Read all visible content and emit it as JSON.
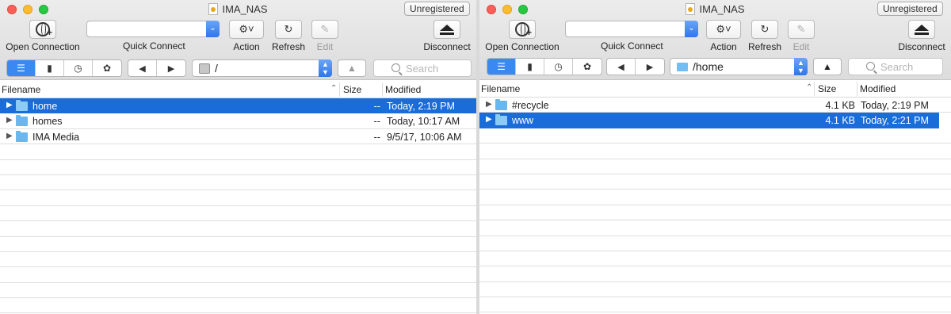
{
  "windows": [
    {
      "title": "IMA_NAS",
      "badge": "Unregistered",
      "toolbar": {
        "open_connection": "Open Connection",
        "quick_connect": "Quick Connect",
        "action": "Action",
        "refresh": "Refresh",
        "edit": "Edit",
        "disconnect": "Disconnect"
      },
      "path": "/",
      "search_placeholder": "Search",
      "columns": {
        "filename": "Filename",
        "size": "Size",
        "modified": "Modified"
      },
      "rows": [
        {
          "name": "home",
          "size": "--",
          "modified": "Today, 2:19 PM",
          "selected": true
        },
        {
          "name": "homes",
          "size": "--",
          "modified": "Today, 10:17 AM",
          "selected": false
        },
        {
          "name": "IMA Media",
          "size": "--",
          "modified": "9/5/17, 10:06 AM",
          "selected": false
        }
      ]
    },
    {
      "title": "IMA_NAS",
      "badge": "Unregistered",
      "toolbar": {
        "open_connection": "Open Connection",
        "quick_connect": "Quick Connect",
        "action": "Action",
        "refresh": "Refresh",
        "edit": "Edit",
        "disconnect": "Disconnect"
      },
      "path": "/home",
      "search_placeholder": "Search",
      "columns": {
        "filename": "Filename",
        "size": "Size",
        "modified": "Modified"
      },
      "rows": [
        {
          "name": "#recycle",
          "size": "4.1 KB",
          "modified": "Today, 2:19 PM",
          "selected": false
        },
        {
          "name": "www",
          "size": "4.1 KB",
          "modified": "Today, 2:21 PM",
          "selected": true
        }
      ]
    }
  ],
  "icons": {
    "open_connection": "globe-plus-icon",
    "action": "gear-icon",
    "refresh": "refresh-icon",
    "edit": "pencil-icon",
    "disconnect": "eject-icon",
    "browser": "list-view-icon",
    "bookmarks": "bookmark-icon",
    "history": "history-icon",
    "bonjour": "bonjour-icon",
    "back": "back-arrow-icon",
    "forward": "forward-arrow-icon",
    "up": "up-arrow-icon",
    "search": "search-icon",
    "folder": "folder-icon"
  },
  "colors": {
    "selection": "#1a6cd9",
    "accent": "#3a89f2",
    "folder": "#6ab6ef"
  }
}
